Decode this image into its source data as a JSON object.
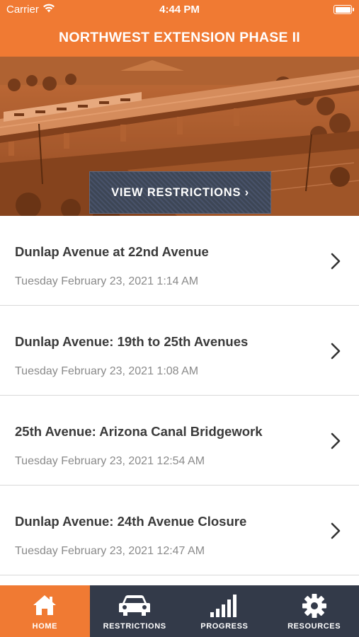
{
  "status_bar": {
    "carrier": "Carrier",
    "time": "4:44 PM"
  },
  "header": {
    "title": "NORTHWEST EXTENSION PHASE II"
  },
  "hero": {
    "button_label": "VIEW RESTRICTIONS ›"
  },
  "restrictions": [
    {
      "title": "Dunlap Avenue at 22nd Avenue",
      "date": "Tuesday February 23, 2021 1:14 AM"
    },
    {
      "title": "Dunlap Avenue: 19th to 25th Avenues",
      "date": "Tuesday February 23, 2021 1:08 AM"
    },
    {
      "title": "25th Avenue: Arizona Canal Bridgework",
      "date": "Tuesday February 23, 2021 12:54 AM"
    },
    {
      "title": "Dunlap Avenue: 24th Avenue Closure",
      "date": "Tuesday February 23, 2021 12:47 AM"
    }
  ],
  "tabs": [
    {
      "label": "HOME",
      "icon": "home-icon",
      "active": true
    },
    {
      "label": "RESTRICTIONS",
      "icon": "car-icon",
      "active": false
    },
    {
      "label": "PROGRESS",
      "icon": "progress-bars-icon",
      "active": false
    },
    {
      "label": "RESOURCES",
      "icon": "gear-icon",
      "active": false
    }
  ],
  "colors": {
    "accent": "#f07a33",
    "tabbar": "#333a49",
    "text": "#3a3a3a",
    "muted": "#8a8a8a"
  }
}
